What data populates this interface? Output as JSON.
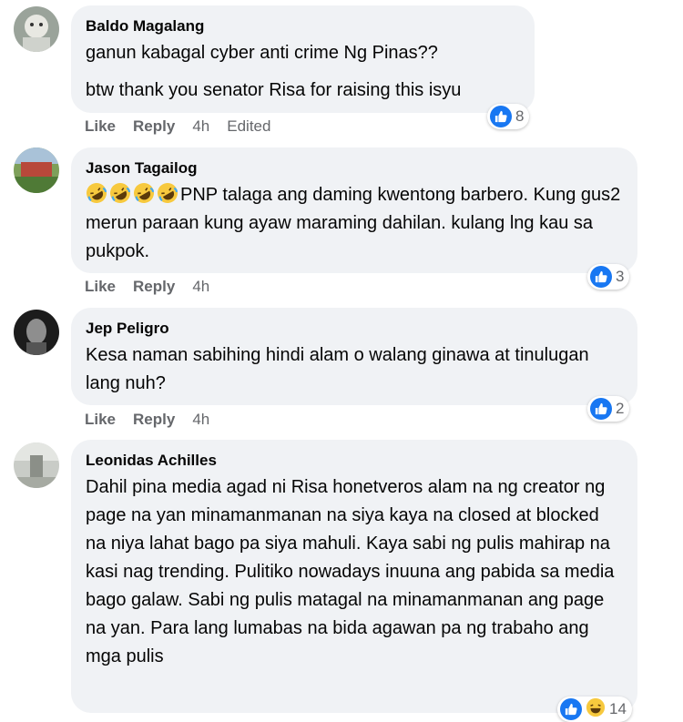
{
  "comments": [
    {
      "author": "Baldo Magalang",
      "lines": [
        "ganun kabagal cyber anti crime Ng Pinas??",
        "btw thank you senator Risa for raising this isyu"
      ],
      "like_label": "Like",
      "reply_label": "Reply",
      "time": "4h",
      "edited": "Edited",
      "reaction_count": "8"
    },
    {
      "author": "Jason Tagailog",
      "text": "PNP talaga ang daming kwentong barbero. Kung gus2 merun paraan kung ayaw maraming dahilan. kulang lng kau sa pukpok.",
      "emoji_count": 4,
      "like_label": "Like",
      "reply_label": "Reply",
      "time": "4h",
      "reaction_count": "3"
    },
    {
      "author": "Jep Peligro",
      "text": "Kesa naman sabihing hindi alam o walang ginawa at tinulugan lang nuh?",
      "like_label": "Like",
      "reply_label": "Reply",
      "time": "4h",
      "reaction_count": "2"
    },
    {
      "author": "Leonidas Achilles",
      "text": "Dahil pina media agad ni Risa honetveros alam na ng creator ng page na yan minamanmanan na siya kaya na closed at blocked na niya lahat bago pa siya mahuli. Kaya sabi ng pulis mahirap na kasi nag trending. Pulitiko nowadays inuuna ang pabida sa media bago galaw. Sabi ng pulis matagal na minamanmanan ang page na yan. Para lang lumabas na bida agawan pa ng trabaho ang mga pulis",
      "reaction_count": "14"
    }
  ],
  "colors": {
    "bubble": "#f0f2f5",
    "meta": "#65676b",
    "like_blue": "#1877f2"
  }
}
